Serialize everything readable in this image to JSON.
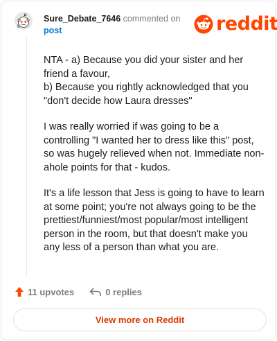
{
  "header": {
    "username": "Sure_Debate_7646",
    "action_text": "commented on",
    "post_link": "post",
    "logo_text": "reddit"
  },
  "comment": {
    "paragraphs": [
      "NTA - a) Because you did your sister and her friend a favour,\nb) Because you rightly acknowledged that you \"don't decide how Laura dresses\"",
      "I was really worried if was going to be a controlling \"I wanted her to dress like this\" post, so was hugely relieved when not. Immediate non-ahole points for that - kudos.",
      "It's a life lesson that Jess is going to have to learn at some point; you're not always going to be the prettiest/funniest/most popular/most intelligent person in the room, but that doesn't make you any less of a person than what you are."
    ]
  },
  "footer": {
    "upvotes": "11 upvotes",
    "replies": "0 replies",
    "view_more": "View more on Reddit"
  },
  "colors": {
    "brand": "#ff4500",
    "link": "#0079d3",
    "view_more_text": "#d93a00"
  },
  "icons": [
    "snoo-avatar-icon",
    "reddit-logo-icon",
    "upvote-arrow-icon",
    "reply-arrow-icon"
  ]
}
